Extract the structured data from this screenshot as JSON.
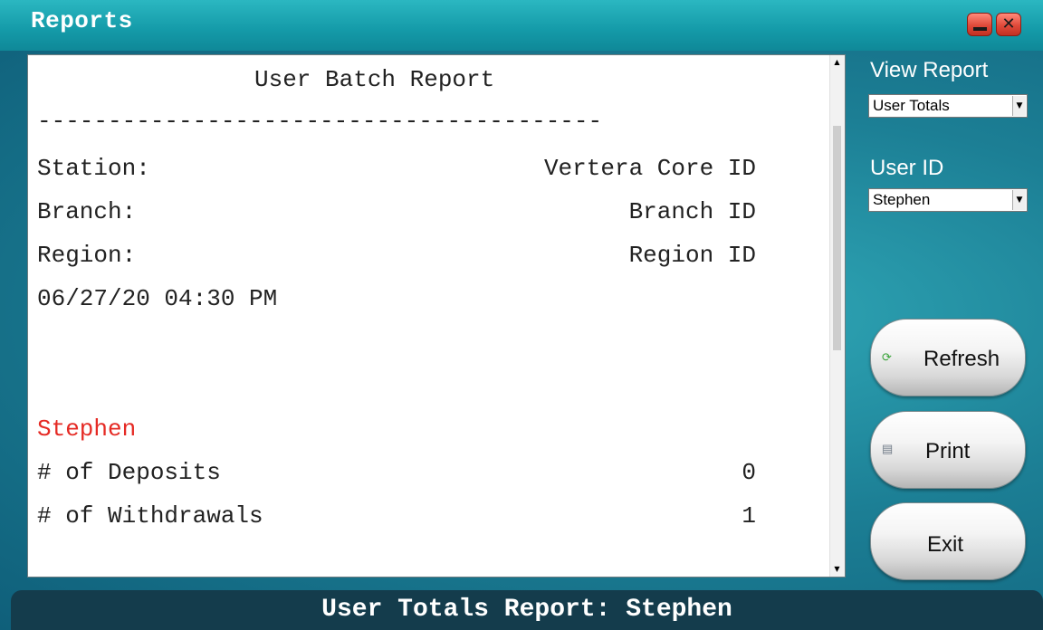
{
  "window": {
    "title": "Reports"
  },
  "report": {
    "heading": "User Batch Report",
    "divider": "----------------------------------------",
    "rows": [
      {
        "label": "Station:",
        "value": "Vertera Core ID"
      },
      {
        "label": "Branch:",
        "value": "Branch ID"
      },
      {
        "label": "Region:",
        "value": "Region ID"
      }
    ],
    "datetime": "06/27/20 04:30 PM",
    "user_name": "Stephen",
    "stats": [
      {
        "label": "# of Deposits",
        "value": "0"
      },
      {
        "label": "# of Withdrawals",
        "value": "1"
      }
    ]
  },
  "sidebar": {
    "view_report_label": "View Report",
    "view_report_value": "User Totals",
    "user_id_label": "User ID",
    "user_id_value": "Stephen",
    "refresh_label": "Refresh",
    "print_label": "Print",
    "exit_label": "Exit"
  },
  "status": {
    "text": "User Totals Report: Stephen"
  },
  "colors": {
    "accent_red": "#e52a24",
    "background_teal": "#1c7f95",
    "status_bar": "#143c4c"
  },
  "icons": {
    "refresh": "refresh-icon",
    "print": "printer-icon",
    "minimize": "minimize-icon",
    "close": "close-icon"
  }
}
